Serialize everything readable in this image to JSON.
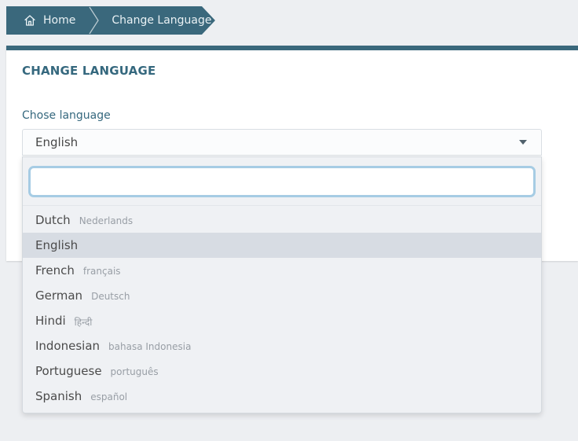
{
  "colors": {
    "accent_teal": "#3a687c",
    "page_background": "#edeff2",
    "dropdown_background": "#eff1f4",
    "selected_row_background": "#d7dce3",
    "search_focus_border": "#a6cce4",
    "heading_text": "#35687e"
  },
  "breadcrumb": {
    "home_label": "Home",
    "home_icon": "home-icon",
    "separator_icon": "chevron-right-icon",
    "current_label": "Change Language"
  },
  "card": {
    "title": "CHANGE LANGUAGE"
  },
  "form": {
    "label": "Chose language",
    "select": {
      "value": "English",
      "icon": "caret-down-icon"
    },
    "search": {
      "value": "",
      "placeholder": ""
    }
  },
  "languages": [
    {
      "name": "Dutch",
      "native": "Nederlands",
      "selected": false
    },
    {
      "name": "English",
      "native": "",
      "selected": true
    },
    {
      "name": "French",
      "native": "français",
      "selected": false
    },
    {
      "name": "German",
      "native": "Deutsch",
      "selected": false
    },
    {
      "name": "Hindi",
      "native": "हिन्दी",
      "selected": false
    },
    {
      "name": "Indonesian",
      "native": "bahasa Indonesia",
      "selected": false
    },
    {
      "name": "Portuguese",
      "native": "português",
      "selected": false
    },
    {
      "name": "Spanish",
      "native": "español",
      "selected": false
    }
  ]
}
